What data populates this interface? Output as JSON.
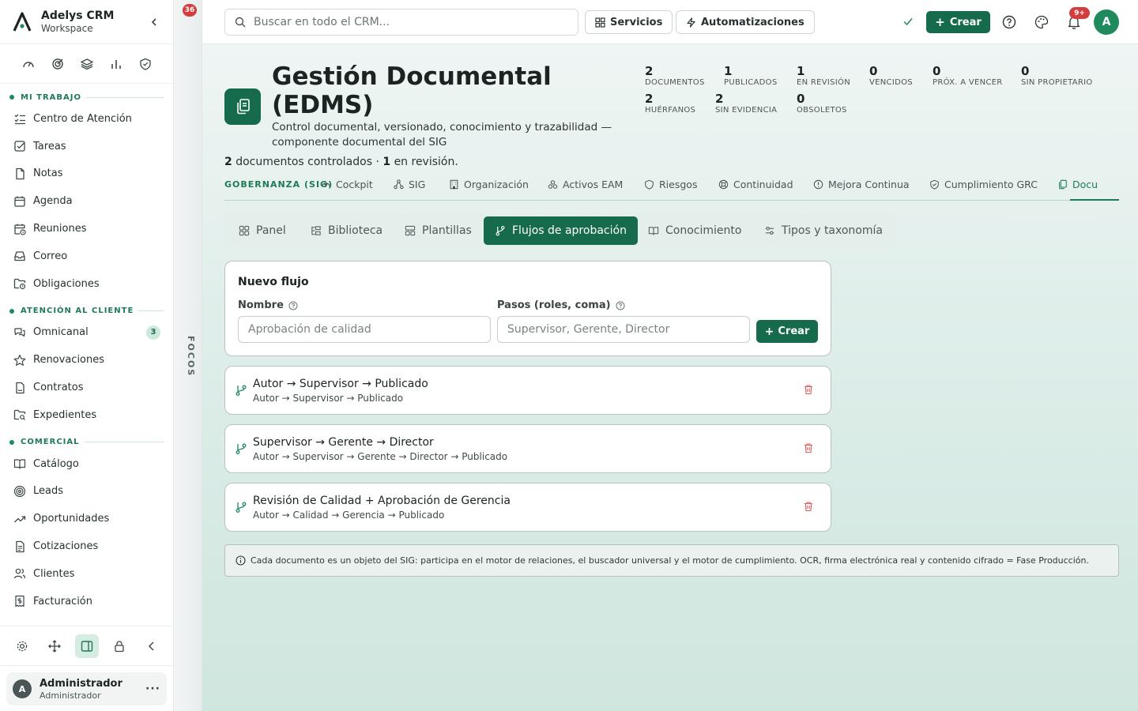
{
  "brand": {
    "title": "Adelys CRM",
    "subtitle": "Workspace"
  },
  "quick_icons": [
    "gauge-icon",
    "target-icon",
    "layers-icon",
    "bar-chart-icon",
    "shield-check-icon"
  ],
  "sections": [
    {
      "title": "MI TRABAJO",
      "items": [
        {
          "label": "Centro de Atención",
          "icon": "list-check-icon"
        },
        {
          "label": "Tareas",
          "icon": "checkbox-icon"
        },
        {
          "label": "Notas",
          "icon": "file-icon"
        },
        {
          "label": "Agenda",
          "icon": "calendar-icon"
        },
        {
          "label": "Reuniones",
          "icon": "calendar-clock-icon"
        },
        {
          "label": "Correo",
          "icon": "inbox-icon"
        },
        {
          "label": "Obligaciones",
          "icon": "folder-clock-icon"
        }
      ]
    },
    {
      "title": "ATENCIÓN AL CLIENTE",
      "items": [
        {
          "label": "Omnicanal",
          "icon": "chat-icon",
          "badge": "3"
        },
        {
          "label": "Renovaciones",
          "icon": "star-icon"
        },
        {
          "label": "Contratos",
          "icon": "contract-icon"
        },
        {
          "label": "Expedientes",
          "icon": "folder-search-icon"
        }
      ]
    },
    {
      "title": "COMERCIAL",
      "items": [
        {
          "label": "Catálogo",
          "icon": "book-icon"
        },
        {
          "label": "Leads",
          "icon": "target-icon"
        },
        {
          "label": "Oportunidades",
          "icon": "trend-icon"
        },
        {
          "label": "Cotizaciones",
          "icon": "document-icon"
        },
        {
          "label": "Clientes",
          "icon": "users-icon"
        },
        {
          "label": "Facturación",
          "icon": "receipt-icon"
        }
      ]
    }
  ],
  "sidebar_tools": [
    "settings-icon",
    "move-icon",
    "panel-icon",
    "lock-icon",
    "chevron-left-icon"
  ],
  "user": {
    "initial": "A",
    "name": "Administrador",
    "role": "Administrador",
    "more": "···"
  },
  "focos": {
    "badge": "36",
    "label": "FOCOS"
  },
  "topbar": {
    "search_placeholder": "Buscar en todo el CRM...",
    "servicios": "Servicios",
    "automatizaciones": "Automatizaciones",
    "crear": "Crear",
    "notif_badge": "9+",
    "avatar": "A"
  },
  "module": {
    "title": "Gestión Documental (EDMS)",
    "description": "Control documental, versionado, conocimiento y trazabilidad — componente documental del SIG",
    "summary": {
      "count_docs": "2",
      "text_docs": "documentos controlados ·",
      "count_rev": "1",
      "text_rev": "en revisión."
    },
    "kpis": [
      {
        "value": "2",
        "label": "DOCUMENTOS"
      },
      {
        "value": "1",
        "label": "PUBLICADOS"
      },
      {
        "value": "1",
        "label": "EN REVISIÓN"
      },
      {
        "value": "0",
        "label": "VENCIDOS"
      },
      {
        "value": "0",
        "label": "PRÓX. A VENCER"
      },
      {
        "value": "0",
        "label": "SIN PROPIETARIO"
      },
      {
        "value": "2",
        "label": "HUÉRFANOS"
      },
      {
        "value": "2",
        "label": "SIN EVIDENCIA"
      },
      {
        "value": "0",
        "label": "OBSOLETOS"
      }
    ]
  },
  "module_tabs": {
    "group": "GOBERNANZA (SIG)",
    "items": [
      "Cockpit",
      "SIG",
      "Organización",
      "Activos EAM",
      "Riesgos",
      "Continuidad",
      "Mejora Continua",
      "Cumplimiento GRC",
      "Docu"
    ]
  },
  "sub_tabs": [
    "Panel",
    "Biblioteca",
    "Plantillas",
    "Flujos de aprobación",
    "Conocimiento",
    "Tipos y taxonomía"
  ],
  "new_flow": {
    "title": "Nuevo flujo",
    "name_label": "Nombre",
    "name_placeholder": "Aprobación de calidad",
    "steps_label": "Pasos (roles, coma)",
    "steps_placeholder": "Supervisor, Gerente, Director",
    "button": "Crear"
  },
  "flows": [
    {
      "title": "Autor → Supervisor → Publicado",
      "steps": "Autor → Supervisor → Publicado"
    },
    {
      "title": "Supervisor → Gerente → Director",
      "steps": "Autor → Supervisor → Gerente → Director → Publicado"
    },
    {
      "title": "Revisión de Calidad + Aprobación de Gerencia",
      "steps": "Autor → Calidad → Gerencia → Publicado"
    }
  ],
  "info": "Cada documento es un objeto del SIG: participa en el motor de relaciones, el buscador universal y el motor de cumplimiento. OCR, firma electrónica real y contenido cifrado = Fase Producción.",
  "colors": {
    "primary": "#176b4d",
    "accent": "#1f8a5e",
    "badge": "#d43d3d"
  }
}
